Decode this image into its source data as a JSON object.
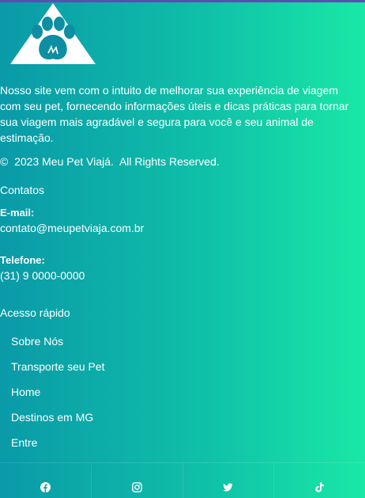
{
  "footer": {
    "about_text": "Nosso site vem com o intuito de melhorar sua experiência de viagem com seu pet, fornecendo informações úteis e dicas práticas para tornar sua viagem mais agradável e segura para você e seu animal de estimação.",
    "copyright_symbol": "©",
    "copyright_text": "2023 Meu Pet Viajá.  All Rights Reserved.",
    "contacts": {
      "title": "Contatos",
      "email_label": "E-mail:",
      "email_value": "contato@meupetviaja.com.br",
      "phone_label": "Telefone:",
      "phone_value": "(31) 9 0000-0000"
    },
    "quick_access": {
      "title": "Acesso rápido",
      "links": [
        "Sobre Nós",
        "Transporte seu Pet",
        "Home",
        "Destinos em MG",
        "Entre"
      ]
    },
    "social_icons": [
      "facebook-icon",
      "instagram-icon",
      "twitter-icon",
      "tiktok-icon"
    ]
  },
  "colors": {
    "gradient_start": "#0a9aa8",
    "gradient_end": "#19e8a6",
    "logo_shape": "#ffffff",
    "logo_paw": "#0d8ea2"
  }
}
